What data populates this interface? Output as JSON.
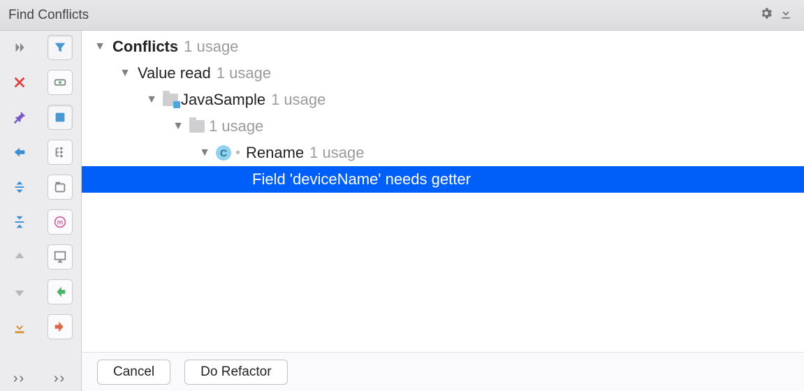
{
  "header": {
    "title": "Find Conflicts"
  },
  "tree": {
    "root": {
      "label": "Conflicts",
      "hint": "1 usage"
    },
    "n1": {
      "label": "Value read",
      "hint": "1 usage"
    },
    "n2": {
      "label": "JavaSample",
      "hint": "1 usage"
    },
    "n3": {
      "label": "",
      "hint": "1 usage"
    },
    "n4": {
      "label": "Rename",
      "hint": "1 usage"
    },
    "n5": {
      "label": "Field 'deviceName' needs getter"
    }
  },
  "footer": {
    "cancel": "Cancel",
    "do_refactor": "Do Refactor"
  }
}
